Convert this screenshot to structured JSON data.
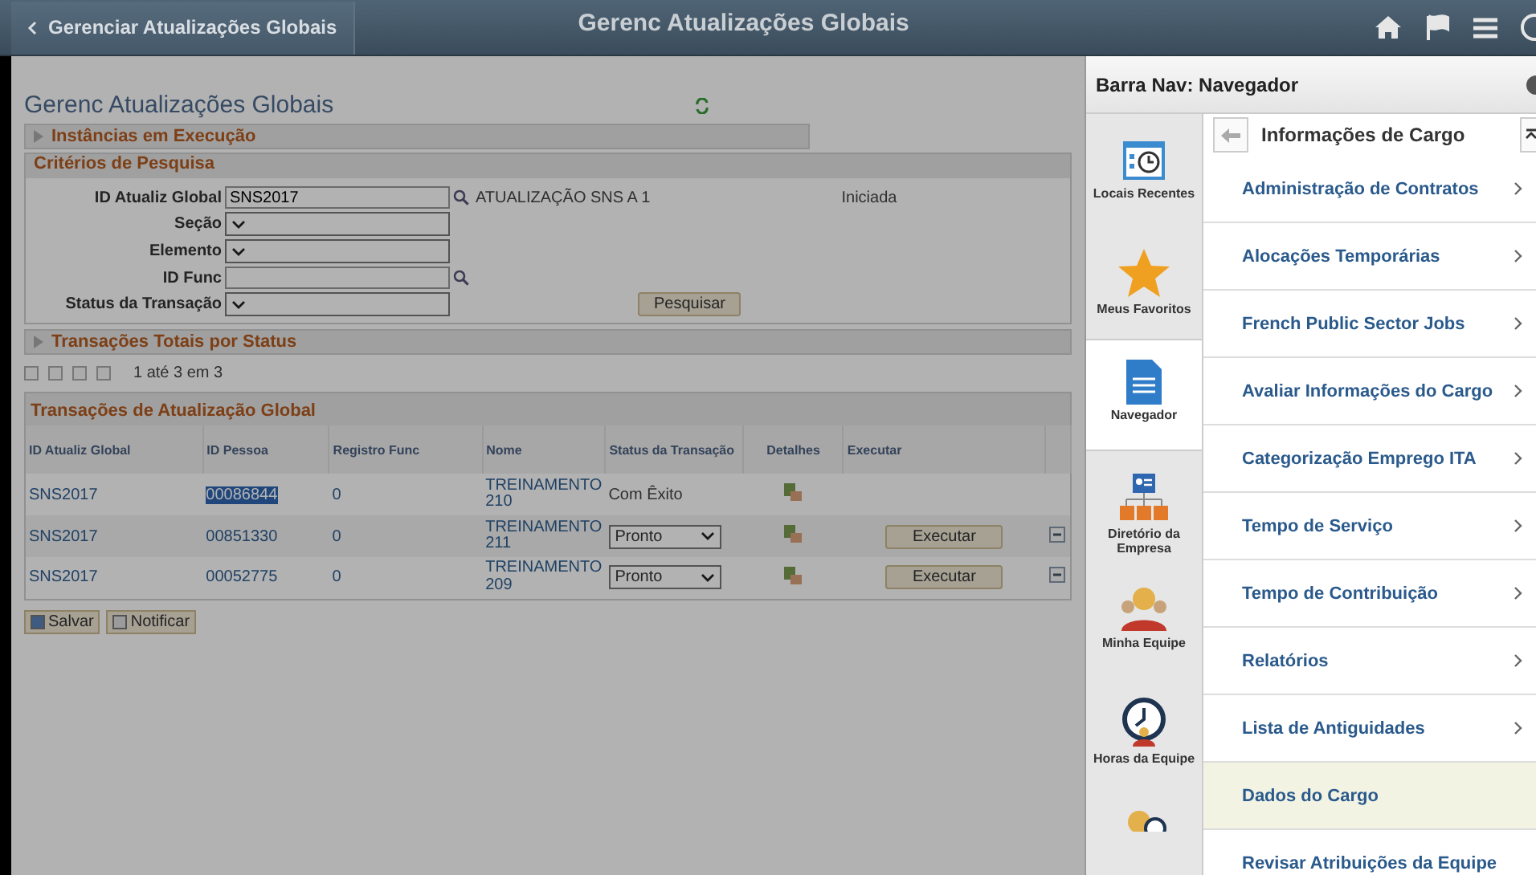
{
  "header": {
    "back_label": "Gerenciar Atualizações Globais",
    "title": "Gerenc Atualizações Globais"
  },
  "page": {
    "title": "Gerenc Atualizações Globais",
    "sections": [
      {
        "label": "Instâncias em Execução",
        "expanded": false
      }
    ],
    "criteria": {
      "title": "Critérios de Pesquisa",
      "fields": [
        {
          "label": "ID Atualiz Global",
          "kind": "lookup",
          "value": "SNS2017",
          "description": "ATUALIZAÇÃO SNS A 1",
          "status": "Iniciada"
        },
        {
          "label": "Seção",
          "kind": "select"
        },
        {
          "label": "Elemento",
          "kind": "select"
        },
        {
          "label": "ID Func",
          "kind": "lookup"
        },
        {
          "label": "Status da Transação",
          "kind": "select"
        }
      ],
      "search_button": "Pesquisar"
    },
    "totals_section": {
      "label": "Transações Totais por Status",
      "expanded": false
    },
    "pager": {
      "text": "1 até 3 em 3"
    },
    "grid": {
      "title": "Transações de Atualização Global",
      "columns": [
        "ID Atualiz Global",
        "ID Pessoa",
        "Registro Func",
        "Nome",
        "Status da Transação",
        "Detalhes",
        "Executar"
      ],
      "rows": [
        {
          "global_id": "SNS2017",
          "person_id": "00086844",
          "selected": true,
          "record": "0",
          "name": "TREINAMENTO 210",
          "kind": "text",
          "status": "Com Êxito"
        },
        {
          "global_id": "SNS2017",
          "person_id": "00851330",
          "selected": false,
          "record": "0",
          "name": "TREINAMENTO 211",
          "kind": "select",
          "status": "Pronto",
          "execute": "Executar"
        },
        {
          "global_id": "SNS2017",
          "person_id": "00052775",
          "selected": false,
          "record": "0",
          "name": "TREINAMENTO 209",
          "kind": "select",
          "status": "Pronto",
          "execute": "Executar"
        }
      ]
    },
    "buttons": [
      "Salvar",
      "Notificar"
    ]
  },
  "navbar": {
    "title": "Barra Nav: Navegador",
    "tiles": [
      {
        "label": "Locais Recentes",
        "kind": "calendar",
        "selected": false
      },
      {
        "label": "Meus Favoritos",
        "kind": "star",
        "selected": false
      },
      {
        "label": "Navegador",
        "kind": "document",
        "selected": true
      },
      {
        "label": "Diretório da Empresa",
        "kind": "org",
        "selected": false
      },
      {
        "label": "Minha Equipe",
        "kind": "team",
        "selected": false
      },
      {
        "label": "Horas da Equipe",
        "kind": "clock",
        "selected": false
      },
      {
        "kind": "person-clock",
        "selected": false
      }
    ],
    "folder": "Informações de Cargo",
    "items": [
      {
        "label": "Administração de Contratos",
        "has_children": true,
        "selected": false
      },
      {
        "label": "Alocações Temporárias",
        "has_children": true,
        "selected": false
      },
      {
        "label": "French Public Sector Jobs",
        "has_children": true,
        "selected": false
      },
      {
        "label": "Avaliar Informações do Cargo",
        "has_children": true,
        "selected": false
      },
      {
        "label": "Categorização Emprego ITA",
        "has_children": true,
        "selected": false
      },
      {
        "label": "Tempo de Serviço",
        "has_children": true,
        "selected": false
      },
      {
        "label": "Tempo de Contribuição",
        "has_children": true,
        "selected": false
      },
      {
        "label": "Relatórios",
        "has_children": true,
        "selected": false
      },
      {
        "label": "Lista de Antiguidades",
        "has_children": true,
        "selected": false
      },
      {
        "label": "Dados do Cargo",
        "has_children": false,
        "selected": true
      },
      {
        "label": "Revisar Atribuições da Equipe",
        "has_children": false,
        "selected": false
      }
    ]
  }
}
